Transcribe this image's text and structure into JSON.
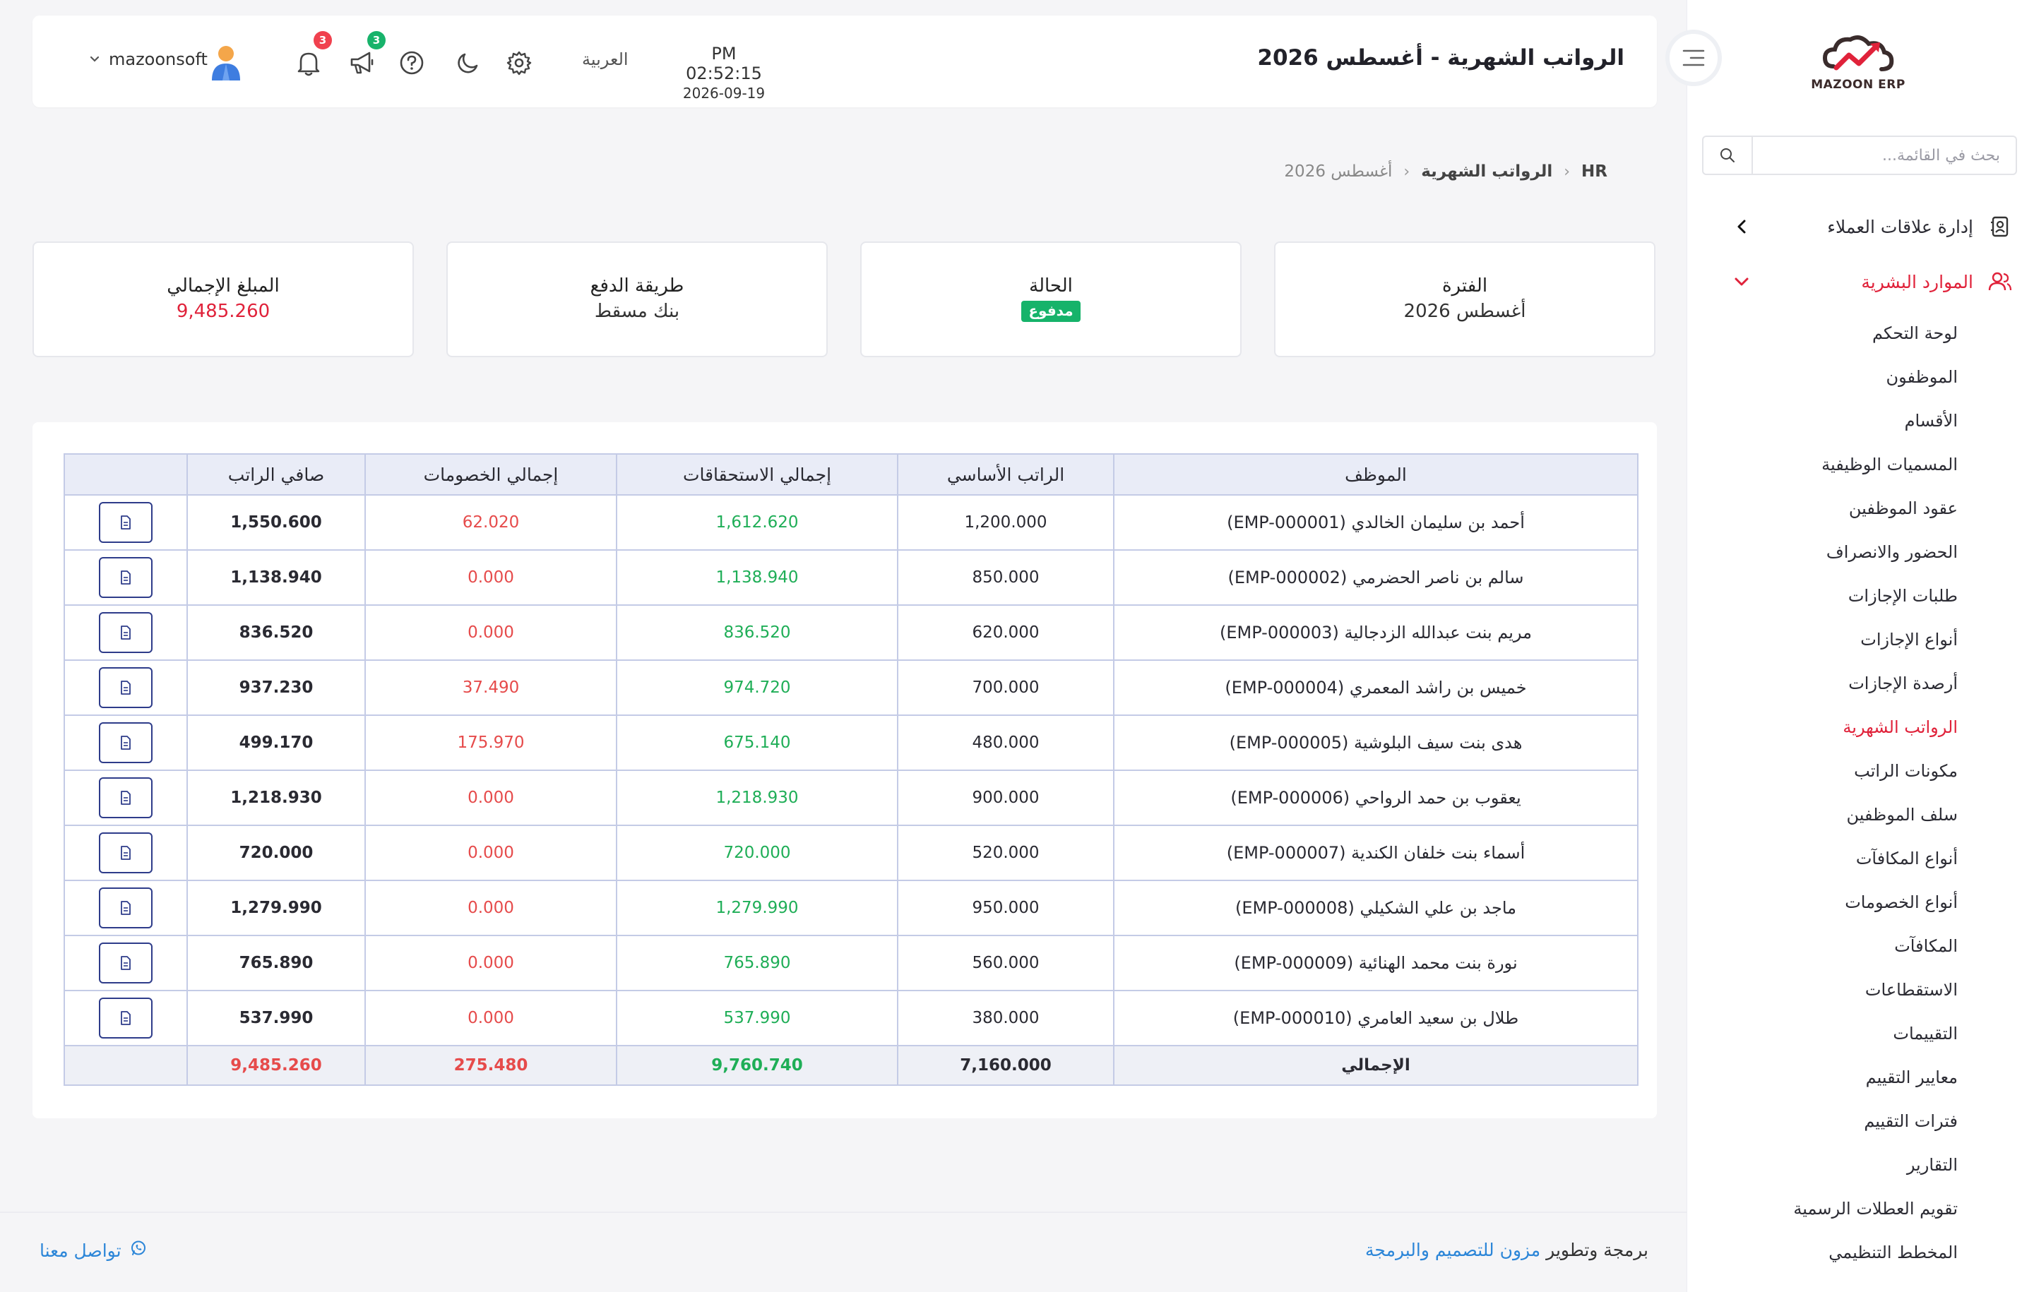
{
  "sidebar": {
    "logo_text": "MAZOON ERP",
    "search_placeholder": "بحث في القائمة...",
    "groups": [
      {
        "label": "إدارة علاقات العملاء"
      },
      {
        "label": "الموارد البشرية"
      }
    ],
    "items": [
      {
        "label": "لوحة التحكم"
      },
      {
        "label": "الموظفون"
      },
      {
        "label": "الأقسام"
      },
      {
        "label": "المسميات الوظيفية"
      },
      {
        "label": "عقود الموظفين"
      },
      {
        "label": "الحضور والانصراف"
      },
      {
        "label": "طلبات الإجازات"
      },
      {
        "label": "أنواع الإجازات"
      },
      {
        "label": "أرصدة الإجازات"
      },
      {
        "label": "الرواتب الشهرية"
      },
      {
        "label": "مكونات الراتب"
      },
      {
        "label": "سلف الموظفين"
      },
      {
        "label": "أنواع المكافآت"
      },
      {
        "label": "أنواع الخصومات"
      },
      {
        "label": "المكافآت"
      },
      {
        "label": "الاستقطاعات"
      },
      {
        "label": "التقييمات"
      },
      {
        "label": "معايير التقييم"
      },
      {
        "label": "فترات التقييم"
      },
      {
        "label": "التقارير"
      },
      {
        "label": "تقويم العطلات الرسمية"
      },
      {
        "label": "المخطط التنظيمي"
      }
    ]
  },
  "header": {
    "title": "الرواتب الشهرية - أغسطس 2026",
    "time": "PM 02:52:15",
    "date": "2026-09-19",
    "language": "العربية",
    "notifications_count": "3",
    "announcements_count": "3",
    "username": "mazoonsoft"
  },
  "breadcrumb": {
    "root": "HR",
    "section": "الرواتب الشهرية",
    "current": "أغسطس 2026"
  },
  "summary": {
    "period_label": "الفترة",
    "period_value": "أغسطس 2026",
    "status_label": "الحالة",
    "status_value": "مدفوع",
    "payment_label": "طريقة الدفع",
    "payment_value": "بنك مسقط",
    "total_label": "المبلغ الإجمالي",
    "total_value": "9,485.260"
  },
  "table": {
    "headers": {
      "employee": "الموظف",
      "basic": "الراتب الأساسي",
      "earnings": "إجمالي الاستحقاقات",
      "deductions": "إجمالي الخصومات",
      "net": "صافي الراتب"
    },
    "rows": [
      {
        "employee": "أحمد بن سليمان الخالدي (EMP-000001)",
        "basic": "1,200.000",
        "earnings": "1,612.620",
        "deductions": "62.020",
        "net": "1,550.600"
      },
      {
        "employee": "سالم بن ناصر الحضرمي (EMP-000002)",
        "basic": "850.000",
        "earnings": "1,138.940",
        "deductions": "0.000",
        "net": "1,138.940"
      },
      {
        "employee": "مريم بنت عبدالله الزدجالية (EMP-000003)",
        "basic": "620.000",
        "earnings": "836.520",
        "deductions": "0.000",
        "net": "836.520"
      },
      {
        "employee": "خميس بن راشد المعمري (EMP-000004)",
        "basic": "700.000",
        "earnings": "974.720",
        "deductions": "37.490",
        "net": "937.230"
      },
      {
        "employee": "هدى بنت سيف البلوشية (EMP-000005)",
        "basic": "480.000",
        "earnings": "675.140",
        "deductions": "175.970",
        "net": "499.170"
      },
      {
        "employee": "يعقوب بن حمد الرواحي (EMP-000006)",
        "basic": "900.000",
        "earnings": "1,218.930",
        "deductions": "0.000",
        "net": "1,218.930"
      },
      {
        "employee": "أسماء بنت خلفان الكندية (EMP-000007)",
        "basic": "520.000",
        "earnings": "720.000",
        "deductions": "0.000",
        "net": "720.000"
      },
      {
        "employee": "ماجد بن علي الشكيلي (EMP-000008)",
        "basic": "950.000",
        "earnings": "1,279.990",
        "deductions": "0.000",
        "net": "1,279.990"
      },
      {
        "employee": "نورة بنت محمد الهنائية (EMP-000009)",
        "basic": "560.000",
        "earnings": "765.890",
        "deductions": "0.000",
        "net": "765.890"
      },
      {
        "employee": "طلال بن سعيد العامري (EMP-000010)",
        "basic": "380.000",
        "earnings": "537.990",
        "deductions": "0.000",
        "net": "537.990"
      }
    ],
    "total": {
      "label": "الإجمالي",
      "basic": "7,160.000",
      "earnings": "9,760.740",
      "deductions": "275.480",
      "net": "9,485.260"
    }
  },
  "footer": {
    "credit_prefix": "برمجة وتطوير",
    "credit_link": "مزون للتصميم والبرمجة",
    "contact": "تواصل معنا"
  },
  "colors": {
    "accent": "#e0223a",
    "positive": "#1fae57",
    "negative": "#e64b4b",
    "paid": "#16b36a",
    "link": "#2c86d8"
  }
}
